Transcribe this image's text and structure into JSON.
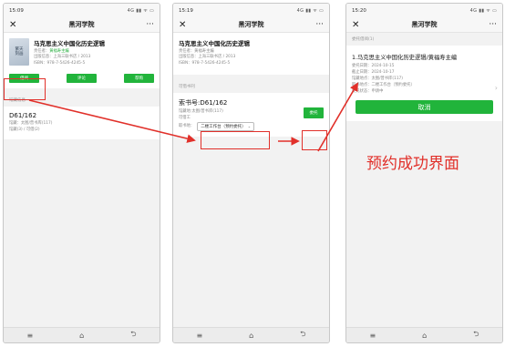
{
  "app_title": "黑河学院",
  "book": {
    "title": "马克思主义中国化历史逻辑",
    "cover_text": [
      "繁天",
      "刻画"
    ],
    "editor_label": "责任者：",
    "editor": "黄福寿主编",
    "publisher_line": "出版信息：上海三联书店 / 2013",
    "isbn_line": "ISBN：978-7-5426-4245-5"
  },
  "phone1": {
    "time": "15:09",
    "signal": "4G ▮▮ ᯤ ▭",
    "buttons": [
      "借阅",
      "评论",
      "荐购"
    ],
    "holdings_label": "馆藏信息",
    "call_number": "D61/162",
    "location": "馆藏：太图/普书库(117)",
    "status": "馆藏(3) / 可借(2)"
  },
  "phone2": {
    "time": "15:19",
    "signal": "4G ▮▮ ᯤ ▭",
    "editor_line": "责任者：黄福寿主编",
    "section_label": "可借书刊",
    "call_number": "索书号:D61/162",
    "location": "馆藏地:太图/普书库(117)",
    "barcode_label": "可借工",
    "pickup_label": "取书地：",
    "pickup_value": "二楼工作台（预约委托）",
    "action_button": "委托"
  },
  "phone3": {
    "time": "15:20",
    "signal": "4G ▮▮ ᯤ ▭",
    "section_label": "委托借阅(1)",
    "appt_title": "1.马克思主义中国化历史逻辑/黄福寿主编",
    "request_date": "委托日期：2024-10-15",
    "expire_date": "截止日期：2024-10-17",
    "location": "馆藏地点：太图/普书库(117)",
    "pickup": "取书地点：二楼工作台（预约委托）",
    "status": "委托状态：申请中",
    "cancel_button": "取消"
  },
  "annotation": "预约成功界面",
  "icons": [
    "close-icon",
    "more-icon",
    "menu-icon",
    "home-icon",
    "back-icon",
    "chevron-right-icon"
  ],
  "colors": {
    "accent_green": "#21b43b",
    "annotation_red": "#e1302a"
  }
}
